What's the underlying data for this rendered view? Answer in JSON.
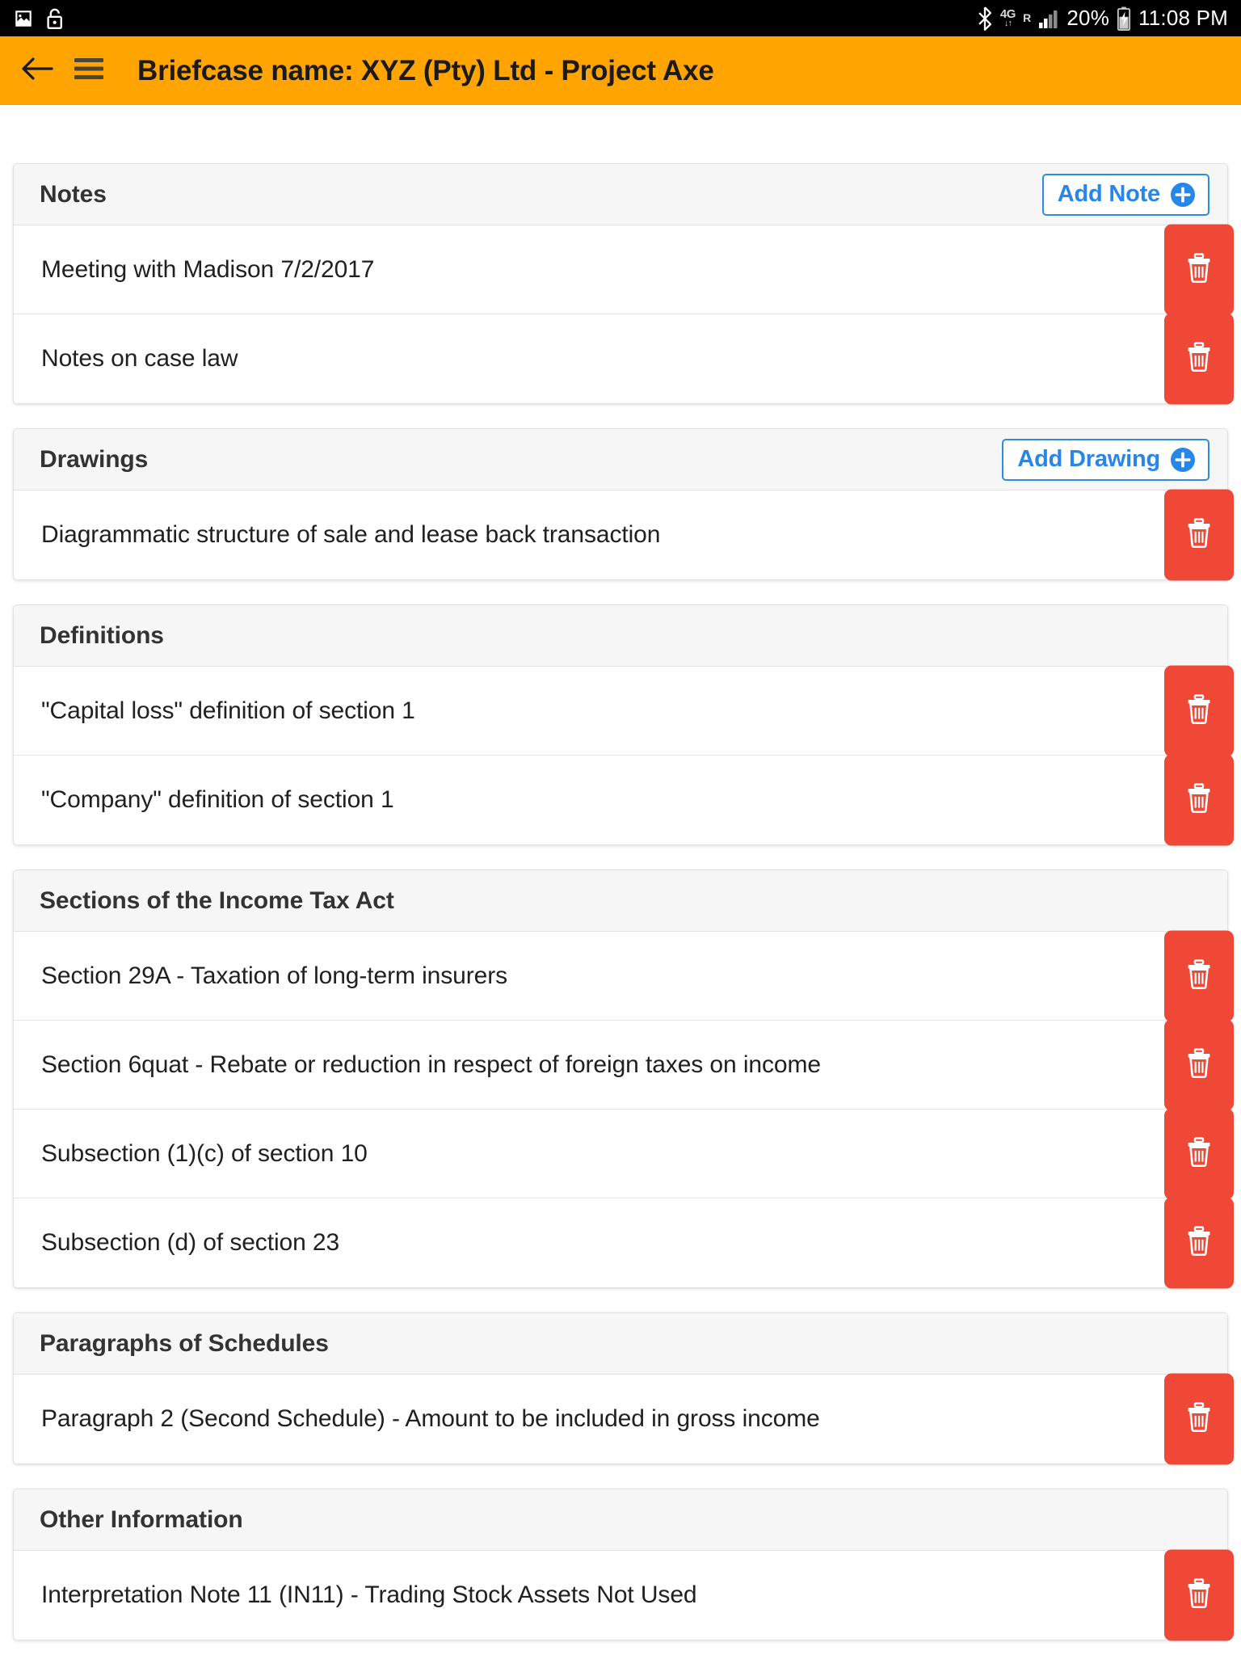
{
  "statusbar": {
    "left_icons": [
      "image-icon",
      "unlocked-padlock-icon"
    ],
    "bluetooth_icon": "bluetooth-icon",
    "network_type": "4G",
    "network_arrows": "↓↑",
    "roaming_label": "R",
    "signal_icon": "signal-bars-icon",
    "battery_percent": "20%",
    "battery_icon": "battery-charging-icon",
    "time": "11:08 PM"
  },
  "appbar": {
    "back_icon": "back-arrow-icon",
    "menu_icon": "hamburger-menu-icon",
    "title": "Briefcase name: XYZ (Pty) Ltd - Project Axe",
    "background_color": "#ffa400"
  },
  "colors": {
    "accent_orange": "#ffa400",
    "link_blue": "#2787e8",
    "delete_red": "#ef4836",
    "header_gray": "#f6f6f6"
  },
  "sections": [
    {
      "title": "Notes",
      "add_label": "Add Note",
      "has_add": true,
      "items": [
        {
          "label": "Meeting with Madison 7/2/2017"
        },
        {
          "label": "Notes on case law"
        }
      ]
    },
    {
      "title": "Drawings",
      "add_label": "Add Drawing",
      "has_add": true,
      "items": [
        {
          "label": "Diagrammatic structure of sale and lease back transaction"
        }
      ]
    },
    {
      "title": "Definitions",
      "add_label": "",
      "has_add": false,
      "items": [
        {
          "label": "\"Capital loss\" definition of section 1"
        },
        {
          "label": "\"Company\" definition of section 1"
        }
      ]
    },
    {
      "title": "Sections of the Income Tax Act",
      "add_label": "",
      "has_add": false,
      "items": [
        {
          "label": "Section 29A - Taxation of long-term insurers"
        },
        {
          "label": "Section 6quat - Rebate or reduction in respect of foreign taxes on income"
        },
        {
          "label": "Subsection (1)(c) of section 10"
        },
        {
          "label": "Subsection (d) of section 23"
        }
      ]
    },
    {
      "title": "Paragraphs of Schedules",
      "add_label": "",
      "has_add": false,
      "items": [
        {
          "label": "Paragraph 2 (Second Schedule) - Amount to be included in gross income"
        }
      ]
    },
    {
      "title": "Other Information",
      "add_label": "",
      "has_add": false,
      "items": [
        {
          "label": "Interpretation Note 11 (IN11) - Trading Stock Assets Not Used"
        }
      ]
    }
  ],
  "delete_icon_name": "trash-icon"
}
